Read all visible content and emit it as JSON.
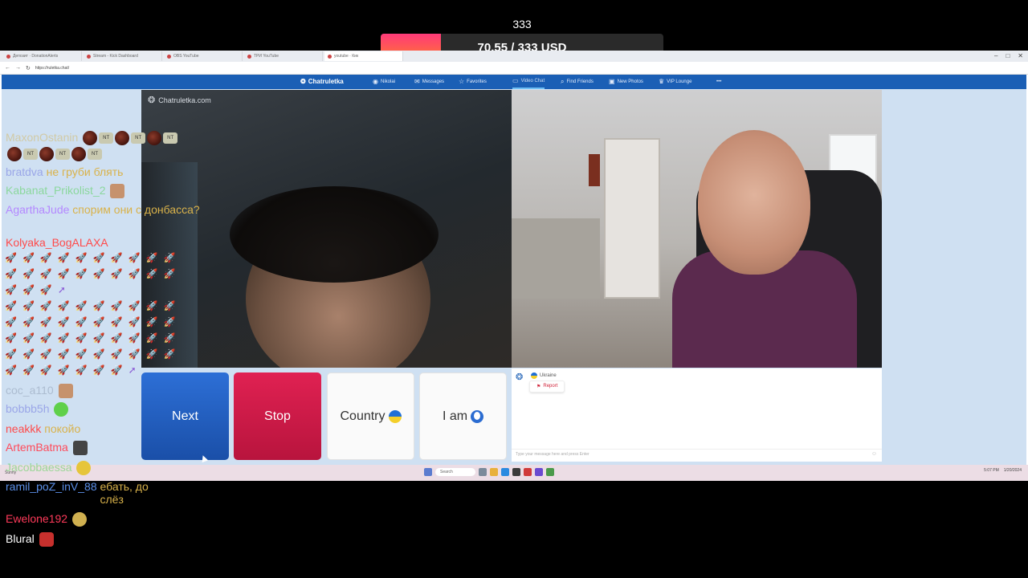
{
  "donation_goal": {
    "count_label": "333",
    "progress_text": "70.55 / 333 USD",
    "current": 70.55,
    "target": 333,
    "min_label": "0",
    "max_label": "333",
    "colors": {
      "fill_start": "#ff3a7a",
      "fill_end": "#ff7a2a"
    }
  },
  "browser": {
    "tabs": [
      "Депозит · DonationAlerts",
      "Stream - Kick Dashboard",
      "OBS YouTube",
      "ТРИ YouTube",
      "youtube · Кик",
      ""
    ],
    "url": "https://ruletka.chat/"
  },
  "site": {
    "brand": "Chatruletka",
    "nav": [
      {
        "label": "Nikolai",
        "icon": "avatar-icon"
      },
      {
        "label": "Messages",
        "icon": "message-icon"
      },
      {
        "label": "Favorites",
        "icon": "star-icon"
      },
      {
        "label": "Video Chat",
        "icon": "video-icon"
      },
      {
        "label": "Find Friends",
        "icon": "search-icon"
      },
      {
        "label": "New Photos",
        "icon": "photo-icon"
      },
      {
        "label": "VIP Lounge",
        "icon": "crown-icon"
      },
      {
        "label": "•••",
        "icon": "more-icon"
      }
    ],
    "watermark": "Chatruletka.com",
    "buttons": {
      "next": "Next",
      "stop": "Stop",
      "country": "Country",
      "iam": "I am"
    },
    "partner_country": "Ukraine",
    "report_label": "Report",
    "chat_placeholder": "Type your message here and press Enter",
    "accent_color": "#1b5fb5"
  },
  "taskbar": {
    "weather": "Sunny",
    "search_placeholder": "Search",
    "time": "5:07 PM",
    "date": "1/20/2024"
  },
  "stream_chat": [
    {
      "user": "MaxonOstanin",
      "user_color": "#d4b04a",
      "message": ""
    },
    {
      "user": "bratdva",
      "user_color": "#9aa6e8",
      "message": "не груби блять",
      "message_color": "#d9b24a"
    },
    {
      "user": "Kabanat_Prikolist_2",
      "user_color": "#4ad04a",
      "message": ""
    },
    {
      "user": "AgarthaJude",
      "user_color": "#b488ff",
      "message": "спорим они с донбасса?",
      "message_color": "#d9b24a"
    },
    {
      "user": "Kolyaka_BogALAXA",
      "user_color": "#ff4a4a",
      "message": ""
    },
    {
      "user": "coc_a110",
      "user_color": "#8a9ab0",
      "message": ""
    },
    {
      "user": "bobbb5h",
      "user_color": "#9aa6e8",
      "message": ""
    },
    {
      "user": "neakkk",
      "user_color": "#ff4a4a",
      "message": "покойо",
      "message_color": "#d9b24a"
    },
    {
      "user": "ArtemBatma",
      "user_color": "#ff4a5a",
      "message": ""
    },
    {
      "user": "Jacobbaessa",
      "user_color": "#4ad04a",
      "message": ""
    },
    {
      "user": "ramil_poZ_inV_88",
      "user_color": "#5b8fe8",
      "message": "ебать, до слёз",
      "message_color": "#d9b24a"
    },
    {
      "user": "Ewelone192",
      "user_color": "#ff3a5a",
      "message": ""
    },
    {
      "user": "Blural",
      "user_color": "#ffffff",
      "message": ""
    }
  ]
}
